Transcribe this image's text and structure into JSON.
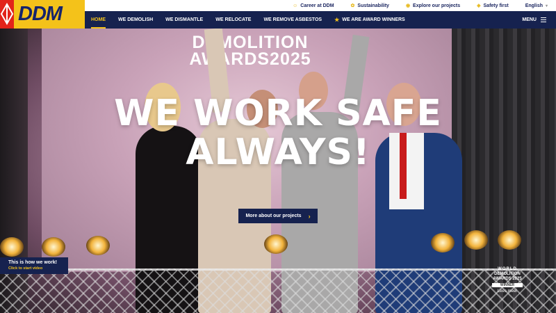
{
  "logo": {
    "text": "DDM"
  },
  "topbar": {
    "links": [
      {
        "label": "Career at DDM",
        "icon": "person-icon"
      },
      {
        "label": "Sustainability",
        "icon": "leaf-icon"
      },
      {
        "label": "Explore our projects",
        "icon": "pin-icon"
      },
      {
        "label": "Safety first",
        "icon": "shield-icon"
      }
    ],
    "language": "English"
  },
  "nav": {
    "items": [
      {
        "label": "HOME",
        "active": true
      },
      {
        "label": "WE DEMOLISH"
      },
      {
        "label": "WE DISMANTLE"
      },
      {
        "label": "WE RELOCATE"
      },
      {
        "label": "WE REMOVE ASBESTOS"
      },
      {
        "label": "WE ARE AWARD WINNERS",
        "icon": "trophy-icon"
      }
    ],
    "menu_label": "MENU"
  },
  "hero": {
    "backdrop_line1": "DEMOLITION",
    "backdrop_line2": "AWARDS2025",
    "headline_line1": "WE WORK SAFE",
    "headline_line2": "ALWAYS!",
    "cta_label": "More about our projects",
    "video_title": "This is how we work!",
    "video_sub": "Click to start video",
    "badge_line1": "WORLD",
    "badge_line2": "DEMOLITION",
    "badge_line3": "AWARDS 2025",
    "badge_line4": "WINNER",
    "badge_line5": "Lees meer"
  },
  "colors": {
    "navy": "#16224f",
    "yellow": "#f4c21a",
    "red": "#e2231a"
  }
}
